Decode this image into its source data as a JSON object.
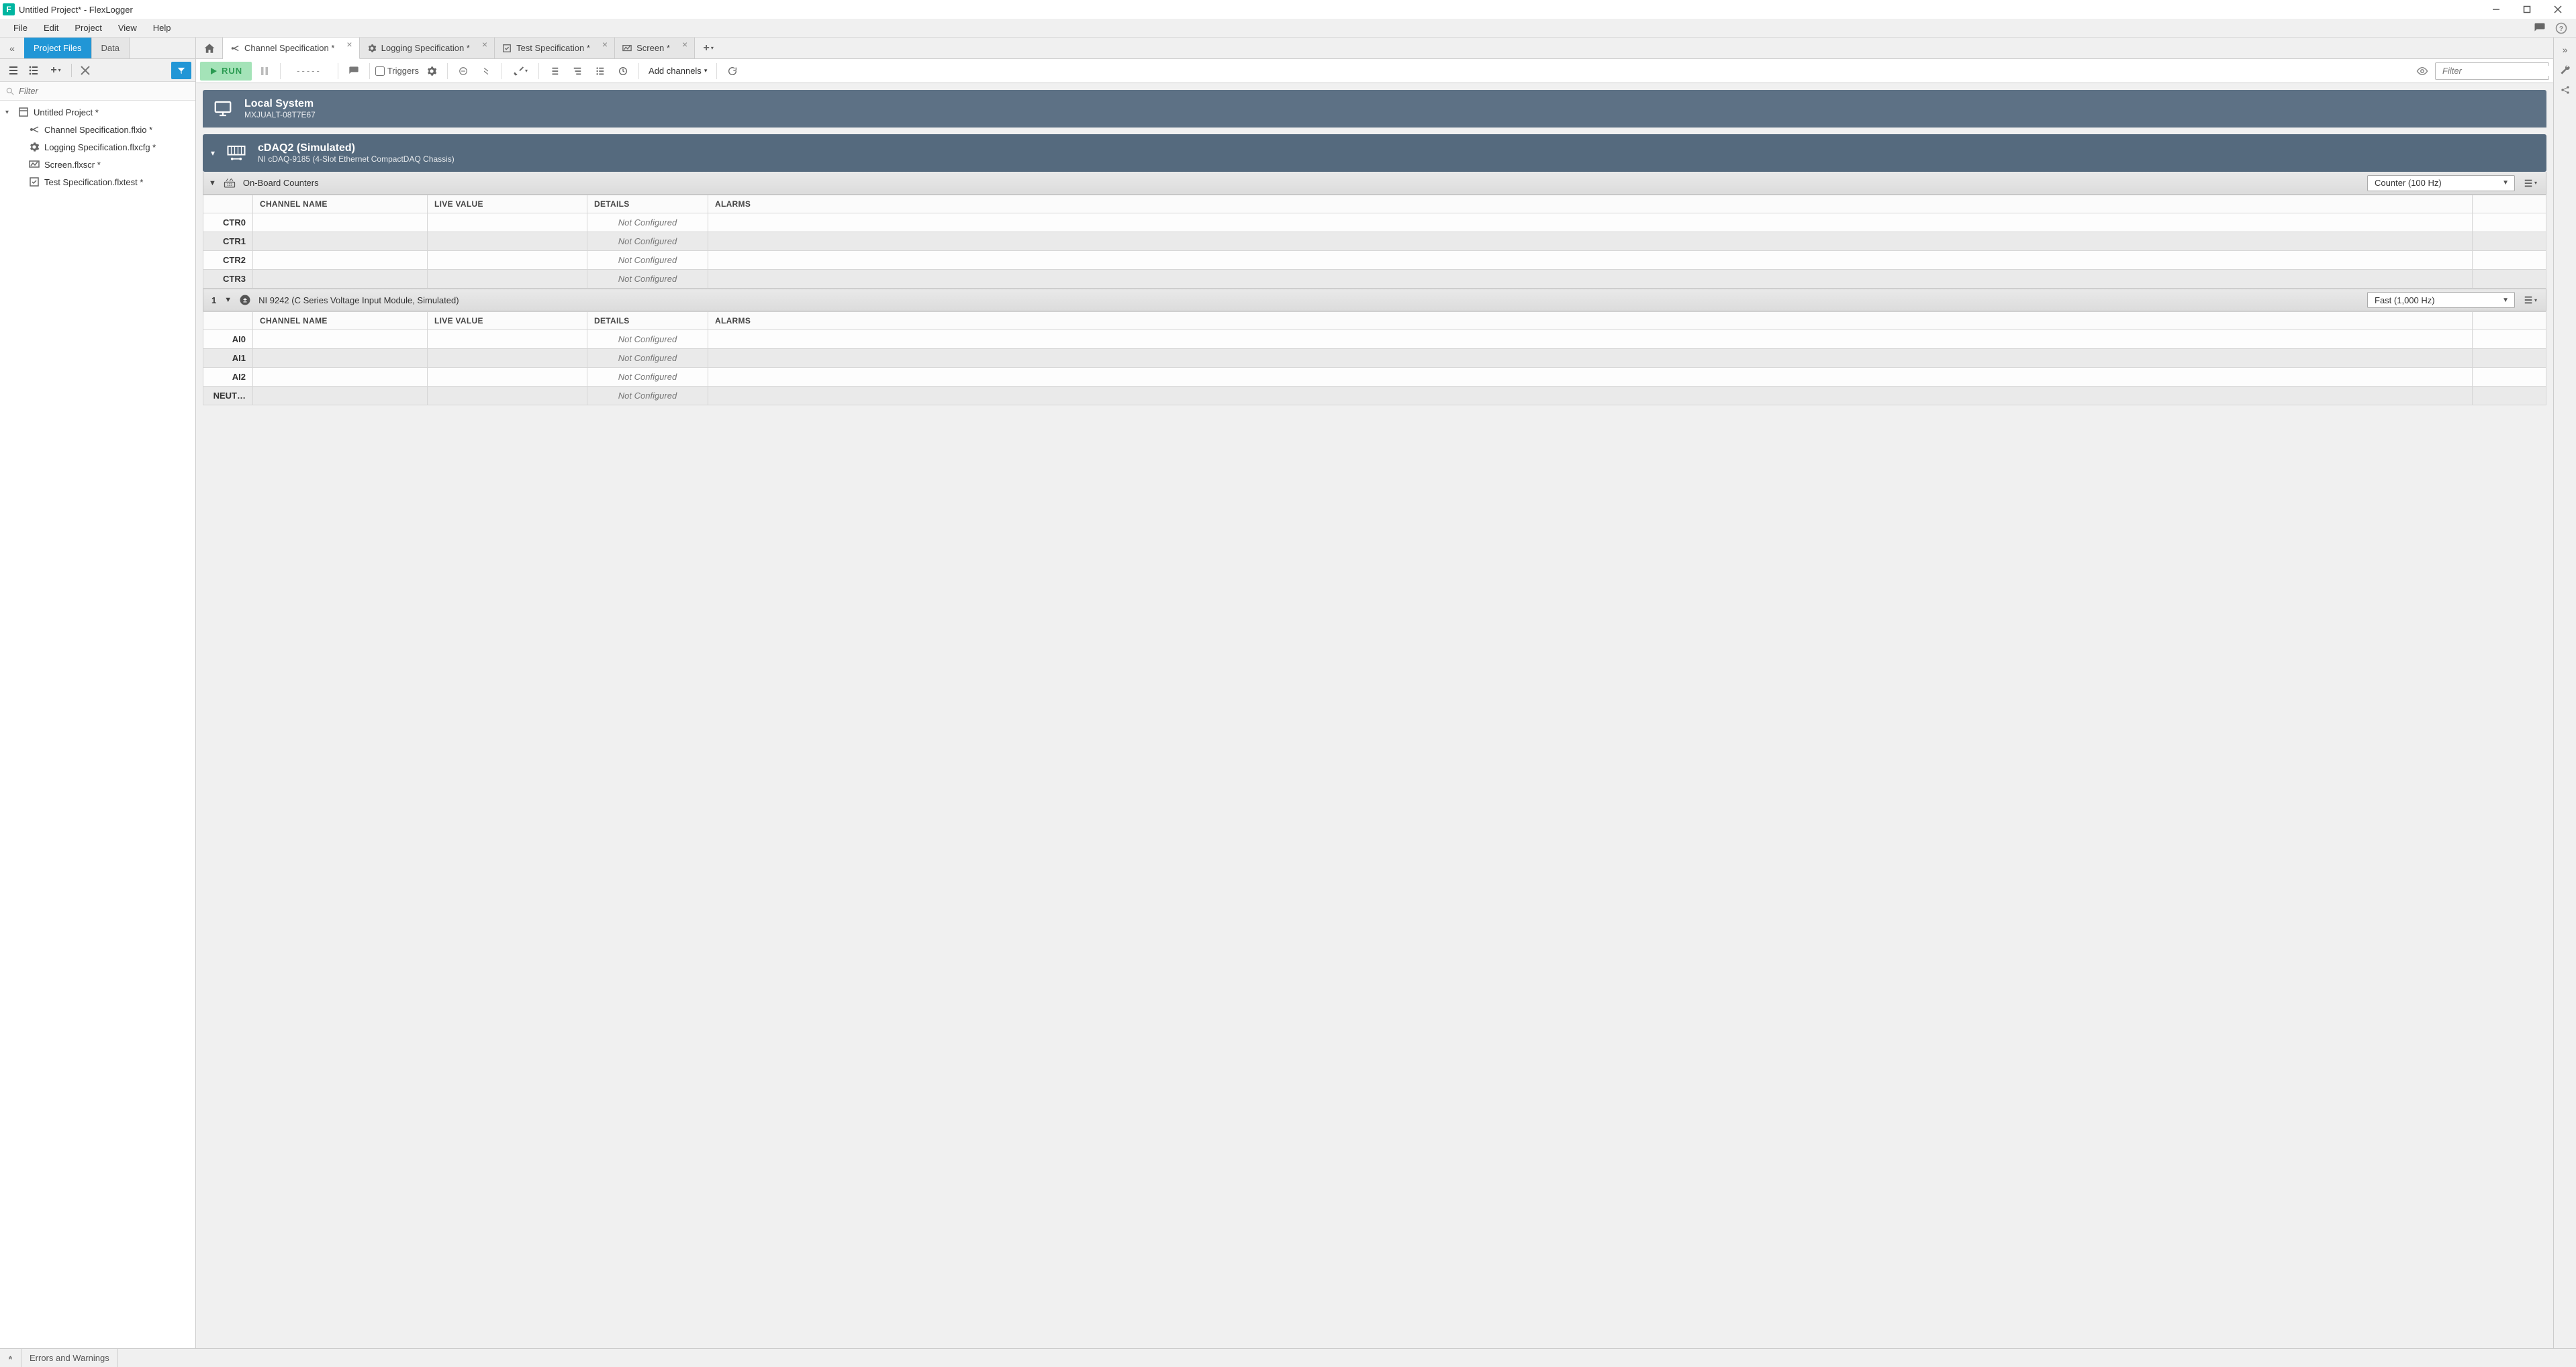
{
  "window": {
    "title": "Untitled Project* - FlexLogger",
    "app_badge": "F"
  },
  "menu": {
    "items": [
      "File",
      "Edit",
      "Project",
      "View",
      "Help"
    ]
  },
  "left_panel": {
    "tabs": {
      "project_files": "Project Files",
      "data": "Data"
    },
    "filter_placeholder": "Filter",
    "root": "Untitled Project *",
    "children": [
      {
        "icon": "channel",
        "label": "Channel Specification.flxio *"
      },
      {
        "icon": "gear",
        "label": "Logging Specification.flxcfg *"
      },
      {
        "icon": "screen",
        "label": "Screen.flxscr *"
      },
      {
        "icon": "test",
        "label": "Test Specification.flxtest *"
      }
    ]
  },
  "main_tabs": [
    {
      "icon": "channel",
      "label": "Channel Specification *",
      "active": true
    },
    {
      "icon": "gear",
      "label": "Logging Specification *",
      "active": false
    },
    {
      "icon": "test",
      "label": "Test Specification *",
      "active": false
    },
    {
      "icon": "screen",
      "label": "Screen *",
      "active": false
    }
  ],
  "toolbar": {
    "run_label": "RUN",
    "status_label": "-----",
    "triggers_label": "Triggers",
    "add_channels_label": "Add channels",
    "filter_placeholder": "Filter"
  },
  "system": {
    "title": "Local System",
    "subtitle": "MXJUALT-08T7E67"
  },
  "device": {
    "title": "cDAQ2 (Simulated)",
    "subtitle": "NI cDAQ-9185 (4-Slot Ethernet CompactDAQ Chassis)"
  },
  "modules": [
    {
      "slot": "",
      "name": "On-Board Counters",
      "rate": "Counter (100 Hz)",
      "columns": [
        "CHANNEL NAME",
        "LIVE VALUE",
        "DETAILS",
        "ALARMS"
      ],
      "rows": [
        {
          "key": "CTR0",
          "channel": "",
          "live": "",
          "details": "Not Configured",
          "alarms": ""
        },
        {
          "key": "CTR1",
          "channel": "",
          "live": "",
          "details": "Not Configured",
          "alarms": ""
        },
        {
          "key": "CTR2",
          "channel": "",
          "live": "",
          "details": "Not Configured",
          "alarms": ""
        },
        {
          "key": "CTR3",
          "channel": "",
          "live": "",
          "details": "Not Configured",
          "alarms": ""
        }
      ]
    },
    {
      "slot": "1",
      "name": "NI 9242 (C Series Voltage Input Module, Simulated)",
      "rate": "Fast (1,000 Hz)",
      "columns": [
        "CHANNEL NAME",
        "LIVE VALUE",
        "DETAILS",
        "ALARMS"
      ],
      "rows": [
        {
          "key": "AI0",
          "channel": "",
          "live": "",
          "details": "Not Configured",
          "alarms": ""
        },
        {
          "key": "AI1",
          "channel": "",
          "live": "",
          "details": "Not Configured",
          "alarms": ""
        },
        {
          "key": "AI2",
          "channel": "",
          "live": "",
          "details": "Not Configured",
          "alarms": ""
        },
        {
          "key": "NEUT…",
          "channel": "",
          "live": "",
          "details": "Not Configured",
          "alarms": ""
        }
      ]
    }
  ],
  "statusbar": {
    "errors_label": "Errors and Warnings"
  }
}
